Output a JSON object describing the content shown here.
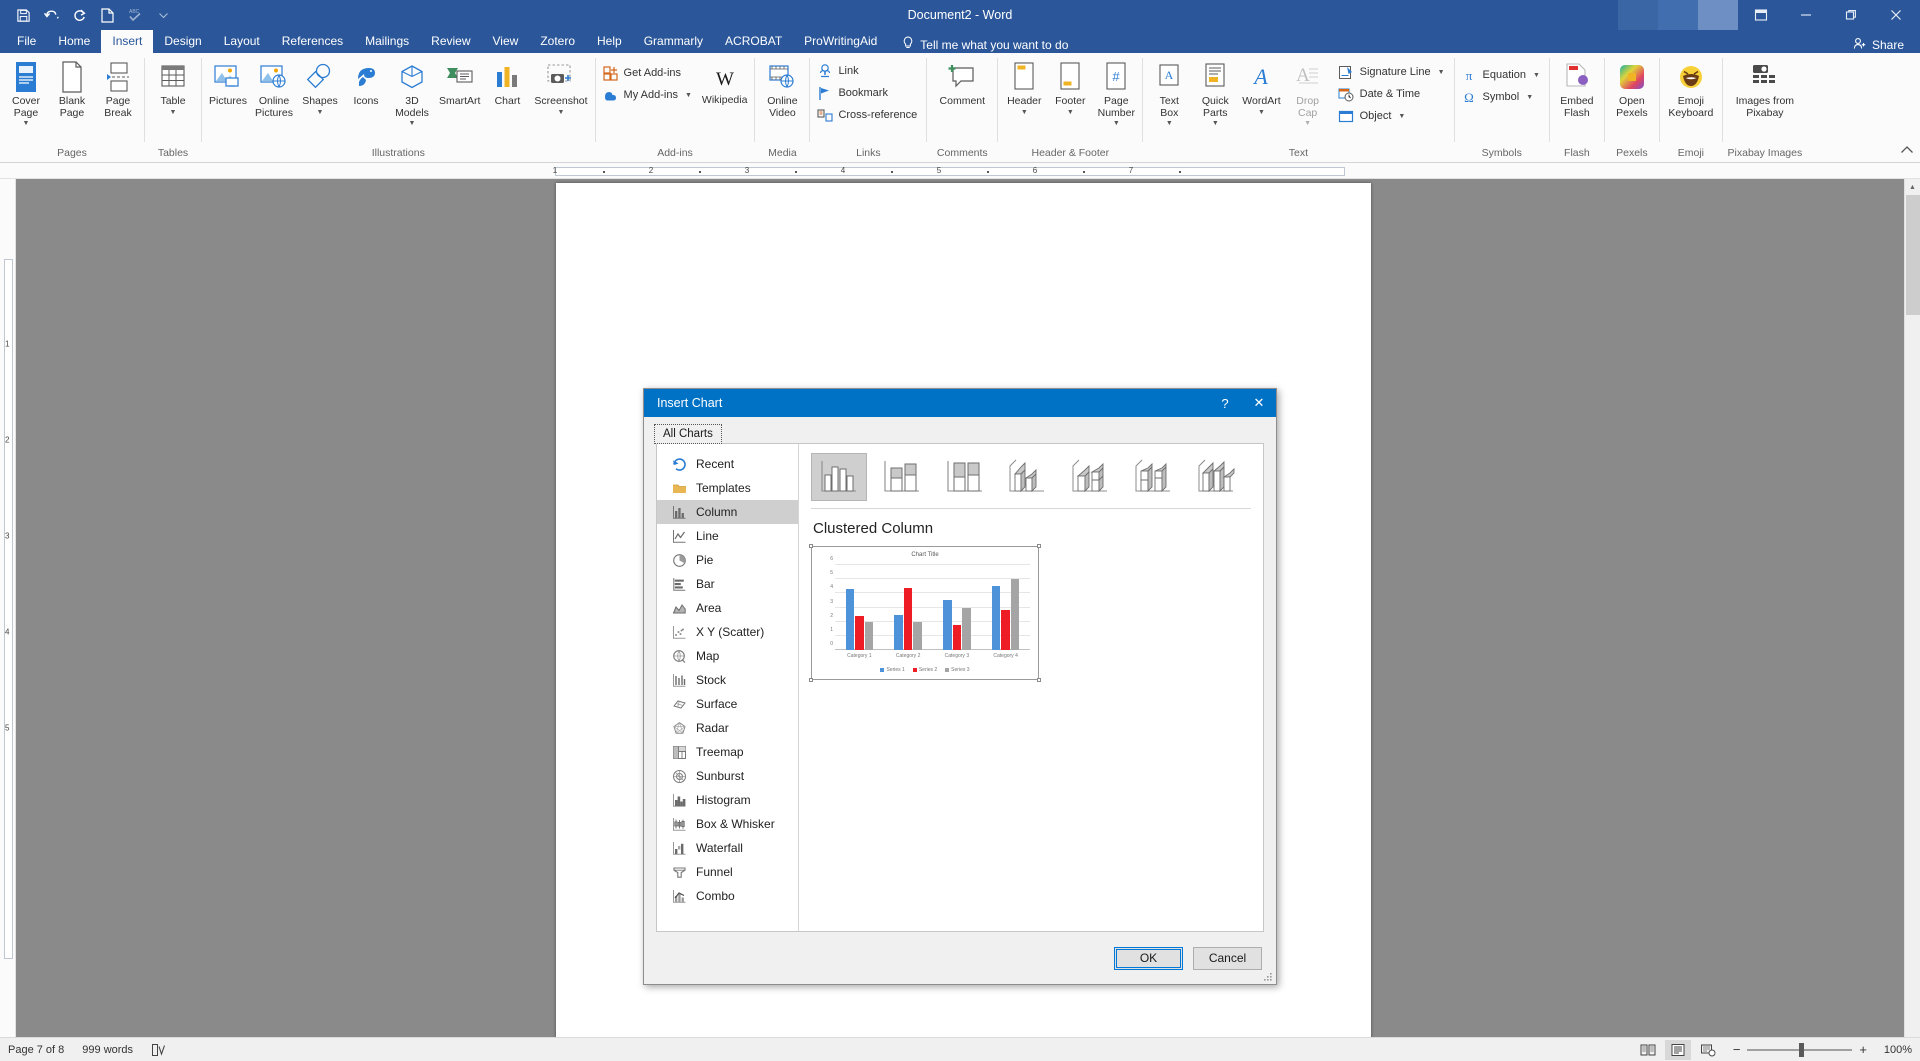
{
  "titlebar": {
    "document_title": "Document2  -  Word",
    "quick_access": [
      {
        "name": "save",
        "icon": "save-icon"
      },
      {
        "name": "undo",
        "icon": "undo-icon"
      },
      {
        "name": "redo",
        "icon": "redo-icon"
      },
      {
        "name": "new",
        "icon": "new-document-icon"
      },
      {
        "name": "spelling",
        "icon": "spelling-check-icon"
      },
      {
        "name": "customize",
        "icon": "chevron-down-icon"
      }
    ],
    "window_buttons": [
      {
        "name": "ribbon-display-options",
        "glyph": "⌷"
      },
      {
        "name": "minimize",
        "glyph": "─"
      },
      {
        "name": "restore",
        "glyph": "❐"
      },
      {
        "name": "close",
        "glyph": "✕"
      }
    ]
  },
  "tabs": [
    {
      "label": "File",
      "active": false
    },
    {
      "label": "Home",
      "active": false
    },
    {
      "label": "Insert",
      "active": true
    },
    {
      "label": "Design",
      "active": false
    },
    {
      "label": "Layout",
      "active": false
    },
    {
      "label": "References",
      "active": false
    },
    {
      "label": "Mailings",
      "active": false
    },
    {
      "label": "Review",
      "active": false
    },
    {
      "label": "View",
      "active": false
    },
    {
      "label": "Zotero",
      "active": false
    },
    {
      "label": "Help",
      "active": false
    },
    {
      "label": "Grammarly",
      "active": false
    },
    {
      "label": "ACROBAT",
      "active": false
    },
    {
      "label": "ProWritingAid",
      "active": false
    }
  ],
  "tell_me": "Tell me what you want to do",
  "share": "Share",
  "ribbon": {
    "groups": [
      {
        "label": "Pages",
        "buttons": [
          {
            "label": "Cover\nPage",
            "caret": true,
            "icon": "cover-page-icon"
          },
          {
            "label": "Blank\nPage",
            "caret": false,
            "icon": "blank-page-icon"
          },
          {
            "label": "Page\nBreak",
            "caret": false,
            "icon": "page-break-icon"
          }
        ]
      },
      {
        "label": "Tables",
        "buttons": [
          {
            "label": "Table",
            "caret": true,
            "icon": "table-icon"
          }
        ]
      },
      {
        "label": "Illustrations",
        "buttons": [
          {
            "label": "Pictures",
            "caret": false,
            "icon": "pictures-icon"
          },
          {
            "label": "Online\nPictures",
            "caret": false,
            "icon": "online-pictures-icon"
          },
          {
            "label": "Shapes",
            "caret": true,
            "icon": "shapes-icon"
          },
          {
            "label": "Icons",
            "caret": false,
            "icon": "icons-icon"
          },
          {
            "label": "3D\nModels",
            "caret": true,
            "icon": "3d-models-icon"
          },
          {
            "label": "SmartArt",
            "caret": false,
            "icon": "smartart-icon"
          },
          {
            "label": "Chart",
            "caret": false,
            "icon": "chart-icon"
          },
          {
            "label": "Screenshot",
            "caret": true,
            "icon": "screenshot-icon"
          }
        ]
      },
      {
        "label": "Add-ins",
        "small_buttons": [
          {
            "label": "Get Add-ins",
            "caret": false,
            "icon": "get-addins-icon"
          },
          {
            "label": "My Add-ins",
            "caret": true,
            "icon": "my-addins-icon"
          }
        ],
        "buttons": [
          {
            "label": "Wikipedia",
            "caret": false,
            "icon": "wikipedia-icon"
          }
        ]
      },
      {
        "label": "Media",
        "buttons": [
          {
            "label": "Online\nVideo",
            "caret": false,
            "icon": "online-video-icon"
          }
        ]
      },
      {
        "label": "Links",
        "small_buttons": [
          {
            "label": "Link",
            "caret": false,
            "icon": "link-icon"
          },
          {
            "label": "Bookmark",
            "caret": false,
            "icon": "bookmark-icon"
          },
          {
            "label": "Cross-reference",
            "caret": false,
            "icon": "cross-reference-icon"
          }
        ]
      },
      {
        "label": "Comments",
        "buttons": [
          {
            "label": "Comment",
            "caret": false,
            "icon": "comment-icon"
          }
        ]
      },
      {
        "label": "Header & Footer",
        "buttons": [
          {
            "label": "Header",
            "caret": true,
            "icon": "header-icon"
          },
          {
            "label": "Footer",
            "caret": true,
            "icon": "footer-icon"
          },
          {
            "label": "Page\nNumber",
            "caret": true,
            "icon": "page-number-icon"
          }
        ]
      },
      {
        "label": "Text",
        "buttons": [
          {
            "label": "Text\nBox",
            "caret": true,
            "icon": "text-box-icon"
          },
          {
            "label": "Quick\nParts",
            "caret": true,
            "icon": "quick-parts-icon"
          },
          {
            "label": "WordArt",
            "caret": true,
            "icon": "wordart-icon"
          },
          {
            "label": "Drop\nCap",
            "caret": true,
            "icon": "drop-cap-icon"
          }
        ],
        "small_buttons": [
          {
            "label": "Signature Line",
            "caret": true,
            "icon": "signature-line-icon"
          },
          {
            "label": "Date & Time",
            "caret": false,
            "icon": "date-time-icon"
          },
          {
            "label": "Object",
            "caret": true,
            "icon": "object-icon"
          }
        ]
      },
      {
        "label": "Symbols",
        "small_buttons": [
          {
            "label": "Equation",
            "caret": true,
            "icon": "equation-icon"
          },
          {
            "label": "Symbol",
            "caret": true,
            "icon": "symbol-icon"
          }
        ]
      },
      {
        "label": "Flash",
        "buttons": [
          {
            "label": "Embed\nFlash",
            "caret": false,
            "icon": "embed-flash-icon"
          }
        ]
      },
      {
        "label": "Pexels",
        "buttons": [
          {
            "label": "Open\nPexels",
            "caret": false,
            "icon": "open-pexels-icon"
          }
        ]
      },
      {
        "label": "Emoji",
        "buttons": [
          {
            "label": "Emoji\nKeyboard",
            "caret": false,
            "icon": "emoji-keyboard-icon"
          }
        ]
      },
      {
        "label": "Pixabay Images",
        "buttons": [
          {
            "label": "Images from\nPixabay",
            "caret": false,
            "icon": "pixabay-images-icon"
          }
        ]
      }
    ]
  },
  "ruler": {
    "h_ticks": [
      "1",
      "2",
      "3",
      "4",
      "5",
      "6",
      "7"
    ],
    "v_ticks": [
      "1",
      "2",
      "3",
      "4",
      "5"
    ]
  },
  "dialog": {
    "title": "Insert Chart",
    "help_glyph": "?",
    "close_glyph": "✕",
    "tab_label": "All Charts",
    "chart_types": [
      {
        "label": "Recent",
        "icon": "recent-icon",
        "selected": false
      },
      {
        "label": "Templates",
        "icon": "templates-folder-icon",
        "selected": false
      },
      {
        "label": "Column",
        "icon": "column-chart-icon",
        "selected": true
      },
      {
        "label": "Line",
        "icon": "line-chart-icon",
        "selected": false
      },
      {
        "label": "Pie",
        "icon": "pie-chart-icon",
        "selected": false
      },
      {
        "label": "Bar",
        "icon": "bar-chart-icon",
        "selected": false
      },
      {
        "label": "Area",
        "icon": "area-chart-icon",
        "selected": false
      },
      {
        "label": "X Y (Scatter)",
        "icon": "scatter-chart-icon",
        "selected": false
      },
      {
        "label": "Map",
        "icon": "map-chart-icon",
        "selected": false
      },
      {
        "label": "Stock",
        "icon": "stock-chart-icon",
        "selected": false
      },
      {
        "label": "Surface",
        "icon": "surface-chart-icon",
        "selected": false
      },
      {
        "label": "Radar",
        "icon": "radar-chart-icon",
        "selected": false
      },
      {
        "label": "Treemap",
        "icon": "treemap-chart-icon",
        "selected": false
      },
      {
        "label": "Sunburst",
        "icon": "sunburst-chart-icon",
        "selected": false
      },
      {
        "label": "Histogram",
        "icon": "histogram-chart-icon",
        "selected": false
      },
      {
        "label": "Box & Whisker",
        "icon": "box-whisker-chart-icon",
        "selected": false
      },
      {
        "label": "Waterfall",
        "icon": "waterfall-chart-icon",
        "selected": false
      },
      {
        "label": "Funnel",
        "icon": "funnel-chart-icon",
        "selected": false
      },
      {
        "label": "Combo",
        "icon": "combo-chart-icon",
        "selected": false
      }
    ],
    "subtypes": [
      {
        "name": "clustered-column",
        "selected": true
      },
      {
        "name": "stacked-column",
        "selected": false
      },
      {
        "name": "100-percent-stacked-column",
        "selected": false
      },
      {
        "name": "3d-clustered-column",
        "selected": false
      },
      {
        "name": "3d-stacked-column",
        "selected": false
      },
      {
        "name": "3d-100-percent-stacked-column",
        "selected": false
      },
      {
        "name": "3d-column",
        "selected": false
      }
    ],
    "selected_subtype_name": "Clustered Column",
    "buttons": {
      "ok": "OK",
      "cancel": "Cancel"
    }
  },
  "chart_data": {
    "type": "bar",
    "title": "Chart Title",
    "categories": [
      "Category 1",
      "Category 2",
      "Category 3",
      "Category 4"
    ],
    "series": [
      {
        "name": "Series 1",
        "color": "#4e93d9",
        "values": [
          4.3,
          2.5,
          3.5,
          4.5
        ]
      },
      {
        "name": "Series 2",
        "color": "#ee1c25",
        "values": [
          2.4,
          4.4,
          1.8,
          2.8
        ]
      },
      {
        "name": "Series 3",
        "color": "#a5a5a5",
        "values": [
          2,
          2,
          3,
          5
        ]
      }
    ],
    "ylim": [
      0,
      6
    ],
    "yticks": [
      "0",
      "1",
      "2",
      "3",
      "4",
      "5",
      "6"
    ],
    "xlabel": "",
    "ylabel": "",
    "grid": true,
    "legend_position": "bottom"
  },
  "statusbar": {
    "page": "Page 7 of 8",
    "words": "999 words",
    "proofing_icon": "proofing-icon",
    "views": [
      {
        "name": "read-mode",
        "active": false
      },
      {
        "name": "print-layout",
        "active": true
      },
      {
        "name": "web-layout",
        "active": false
      }
    ],
    "zoom_out": "−",
    "zoom_in": "+",
    "zoom_value": "100%"
  }
}
